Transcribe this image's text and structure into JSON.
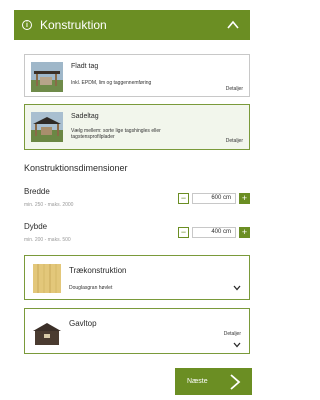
{
  "header": {
    "title": "Konstruktion",
    "info_icon": "i"
  },
  "roof_options": [
    {
      "title": "Fladt tag",
      "subtitle": "Inkl. EPDM, lim og taggennemføring",
      "details": "Detaljer",
      "selected": false
    },
    {
      "title": "Sadeltag",
      "subtitle": "Vælg mellem: sorte lige tagshingles eller tagstensprofilplader",
      "details": "Detaljer",
      "selected": true
    }
  ],
  "dimensions": {
    "title": "Konstruktionsdimensioner",
    "width": {
      "label": "Bredde",
      "hint": "min. 250 - maks. 2000",
      "value": "600 cm",
      "minus": "−",
      "plus": "+"
    },
    "depth": {
      "label": "Dybde",
      "hint": "min. 200 - maks. 500",
      "value": "400 cm",
      "minus": "−",
      "plus": "+"
    }
  },
  "wood": {
    "title": "Trækonstruktion",
    "subtitle": "Douglasgran høvlet"
  },
  "gable": {
    "title": "Gavltop",
    "details": "Detaljer"
  },
  "footer": {
    "next_label": "Næste"
  },
  "colors": {
    "accent": "#6b8e23",
    "selected_bg": "#f2f6ec"
  }
}
